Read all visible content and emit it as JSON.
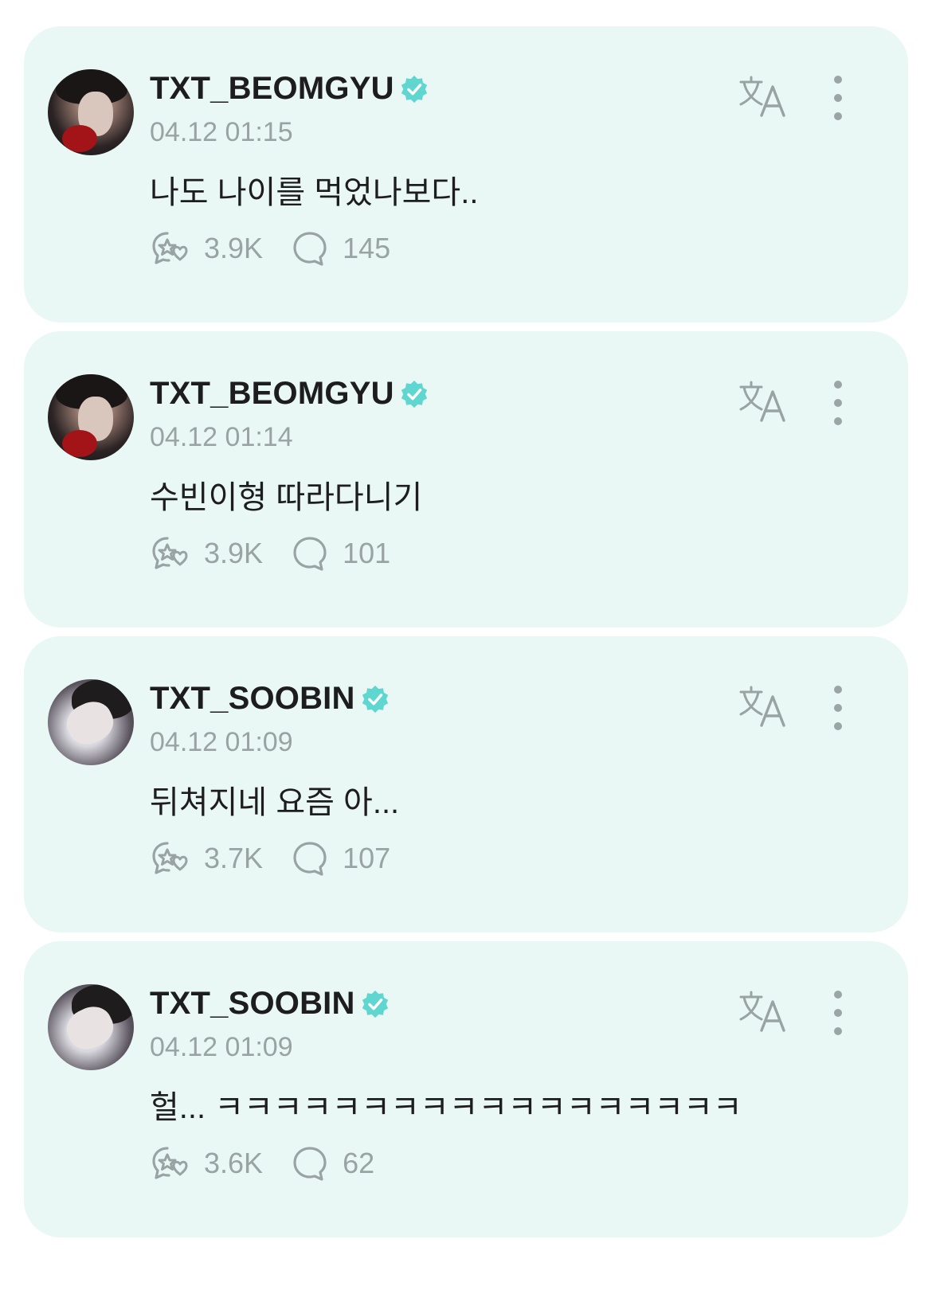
{
  "colors": {
    "card_background": "#e9f8f5",
    "verified_badge": "#5fd7d0",
    "muted_text": "#9aa3a3",
    "primary_text": "#1d1d1d"
  },
  "posts": [
    {
      "username": "TXT_BEOMGYU",
      "verified": true,
      "timestamp": "04.12 01:15",
      "text": "나도 나이를 먹었나보다..",
      "likes": "3.9K",
      "comments": "145",
      "avatar": "beomgyu"
    },
    {
      "username": "TXT_BEOMGYU",
      "verified": true,
      "timestamp": "04.12 01:14",
      "text": "수빈이형 따라다니기",
      "likes": "3.9K",
      "comments": "101",
      "avatar": "beomgyu"
    },
    {
      "username": "TXT_SOOBIN",
      "verified": true,
      "timestamp": "04.12 01:09",
      "text": "뒤쳐지네 요즘 아...",
      "likes": "3.7K",
      "comments": "107",
      "avatar": "soobin"
    },
    {
      "username": "TXT_SOOBIN",
      "verified": true,
      "timestamp": "04.12 01:09",
      "text": "헐... ㅋㅋㅋㅋㅋㅋㅋㅋㅋㅋㅋㅋㅋㅋㅋㅋㅋㅋ",
      "likes": "3.6K",
      "comments": "62",
      "avatar": "soobin"
    }
  ],
  "icons": {
    "like": "star-heart-bubble-icon",
    "comment": "speech-bubble-icon",
    "translate": "translate-icon",
    "more": "vertical-ellipsis-icon",
    "verified": "verified-badge-icon"
  }
}
